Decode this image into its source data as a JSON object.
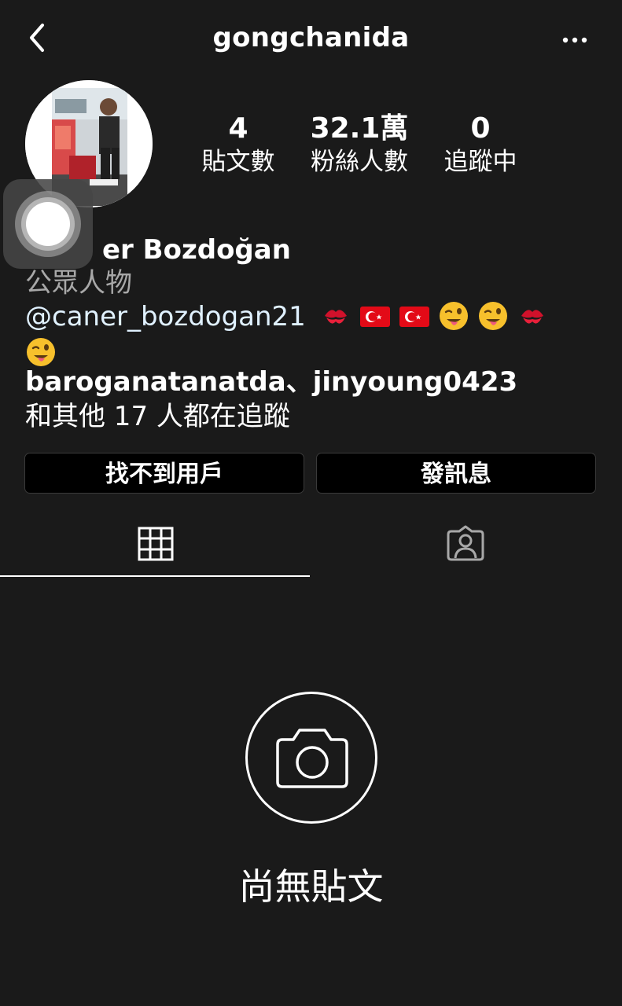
{
  "header": {
    "username": "gongchanida",
    "back_icon": "chevron-left-icon",
    "more_icon": "more-horizontal-icon"
  },
  "profile": {
    "stats": [
      {
        "value": "4",
        "label": "貼文數"
      },
      {
        "value": "32.1萬",
        "label": "粉絲人數"
      },
      {
        "value": "0",
        "label": "追蹤中"
      }
    ],
    "name_visible": "er Bozdoğan",
    "category": "公眾人物",
    "bio_mention": "@caner_bozdogan21",
    "bio_emojis": [
      "kiss-mark",
      "turkey-flag",
      "turkey-flag",
      "winking-tongue-face",
      "winking-tongue-face",
      "kiss-mark",
      "winking-tongue-face"
    ],
    "followed_by_users": "baroganatanatda、jinyoung0423",
    "followed_by_rest": "和其他 17 人都在追蹤"
  },
  "actions": {
    "primary_label": "找不到用戶",
    "message_label": "發訊息"
  },
  "tabs": [
    {
      "icon": "grid-icon",
      "active": true
    },
    {
      "icon": "tagged-person-icon",
      "active": false
    }
  ],
  "empty_state": {
    "icon": "camera-icon",
    "text": "尚無貼文"
  },
  "colors": {
    "background": "#1a1a1a",
    "text": "#ffffff",
    "muted_text": "#a8a8a8",
    "mention": "#e0f1ff",
    "button_bg": "#000000",
    "button_border": "#3a3a3a"
  }
}
